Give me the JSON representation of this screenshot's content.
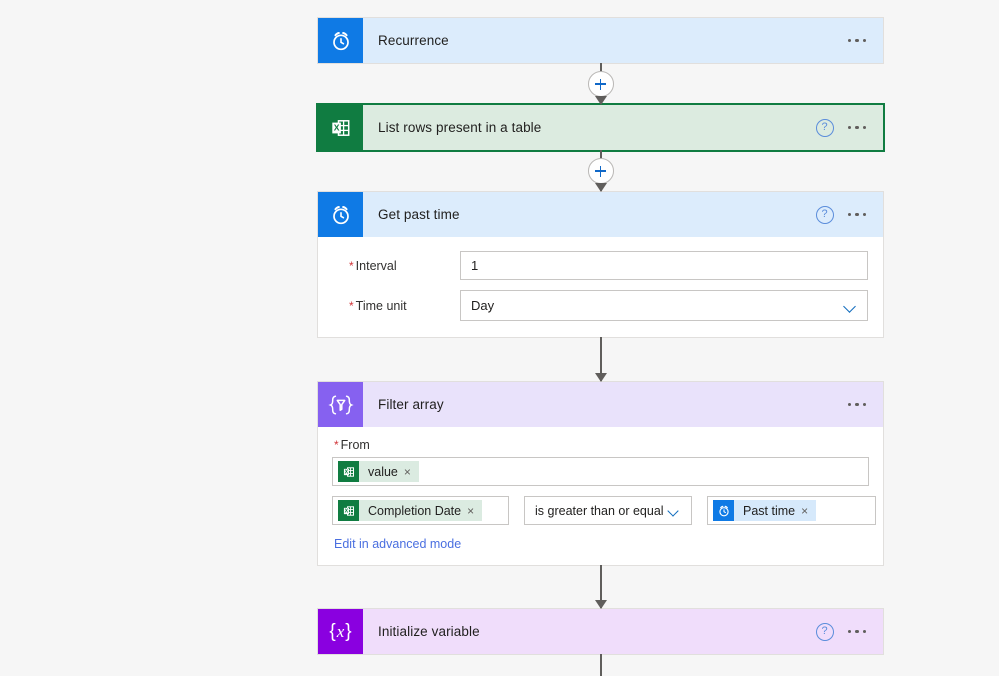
{
  "page": {
    "background_color": "#f6f6f6",
    "accent_blue": "#0f7ae5",
    "excel_green": "#107c41",
    "violet": "#8661f0",
    "purple": "#8a00e0",
    "link_color": "#4a6fe0",
    "required_color": "#d13438"
  },
  "steps": [
    {
      "id": "recurrence",
      "title": "Recurrence",
      "icon": "alarm-clock-icon",
      "icon_color": "blue",
      "header_color": "blue",
      "selected": false,
      "has_help": false,
      "has_ellipsis": true,
      "expanded": false
    },
    {
      "id": "list-rows-present-in-a-table",
      "title": "List rows present in a table",
      "icon": "excel-table-icon",
      "icon_color": "green",
      "header_color": "green",
      "selected": true,
      "has_help": true,
      "has_ellipsis": true,
      "expanded": false
    },
    {
      "id": "get-past-time",
      "title": "Get past time",
      "icon": "alarm-clock-icon",
      "icon_color": "blue",
      "header_color": "blue",
      "selected": false,
      "has_help": true,
      "has_ellipsis": true,
      "expanded": true,
      "fields": [
        {
          "label": "Interval",
          "required": true,
          "type": "text",
          "value": "1"
        },
        {
          "label": "Time unit",
          "required": true,
          "type": "select",
          "value": "Day"
        }
      ]
    },
    {
      "id": "filter-array",
      "title": "Filter array",
      "icon": "filter-braces-icon",
      "icon_color": "violet",
      "header_color": "violet",
      "selected": false,
      "has_help": false,
      "has_ellipsis": true,
      "expanded": true,
      "from": {
        "label": "From",
        "required": true,
        "token": {
          "label": "value",
          "icon": "excel-table-icon",
          "icon_color": "green",
          "chip_style": "greenish",
          "remove_label": "×"
        }
      },
      "condition": {
        "left": {
          "label": "Completion Date",
          "icon": "excel-table-icon",
          "icon_color": "green",
          "chip_style": "greenish",
          "remove_label": "×"
        },
        "operator": "is greater than or equal ...",
        "right": {
          "label": "Past time",
          "icon": "alarm-clock-icon",
          "icon_color": "blue",
          "chip_style": "bluish",
          "remove_label": "×"
        }
      },
      "advanced_link": "Edit in advanced mode"
    },
    {
      "id": "initialize-variable",
      "title": "Initialize variable",
      "icon": "braces-x-icon",
      "icon_color": "purple",
      "header_color": "purple",
      "selected": false,
      "has_help": true,
      "has_ellipsis": true,
      "expanded": false
    }
  ],
  "connectors": [
    {
      "id": "conn-1",
      "has_plus": true,
      "has_arrow": true
    },
    {
      "id": "conn-2",
      "has_plus": true,
      "has_arrow": true
    },
    {
      "id": "conn-3",
      "has_plus": false,
      "has_arrow": true
    },
    {
      "id": "conn-4",
      "has_plus": false,
      "has_arrow": true
    },
    {
      "id": "conn-5",
      "has_plus": false,
      "has_arrow": false
    }
  ],
  "icons": {
    "help": "?",
    "ellipsis": "•••"
  }
}
